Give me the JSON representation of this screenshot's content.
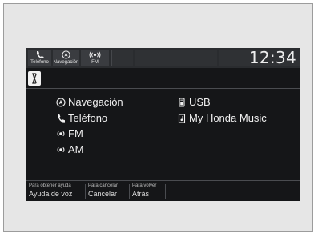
{
  "top_bar": {
    "buttons": [
      {
        "label": "Teléfono",
        "icon": "phone-icon"
      },
      {
        "label": "Navegación",
        "icon": "navigation-icon"
      },
      {
        "label": "FM",
        "icon": "radio-icon"
      }
    ],
    "clock": "12:34"
  },
  "voice_button": {
    "icon": "voice-icon"
  },
  "menu": {
    "left": [
      {
        "label": "Navegación",
        "icon": "navigation-icon"
      },
      {
        "label": "Teléfono",
        "icon": "phone-icon"
      },
      {
        "label": "FM",
        "icon": "radio-icon"
      },
      {
        "label": "AM",
        "icon": "radio-icon"
      }
    ],
    "right": [
      {
        "label": "USB",
        "icon": "usb-icon"
      },
      {
        "label": "My Honda Music",
        "icon": "music-icon"
      }
    ]
  },
  "bottom_bar": [
    {
      "hint": "Para obtener ayuda",
      "label": "Ayuda de voz"
    },
    {
      "hint": "Para cancelar",
      "label": "Cancelar"
    },
    {
      "hint": "Para volver",
      "label": "Atrás"
    }
  ]
}
